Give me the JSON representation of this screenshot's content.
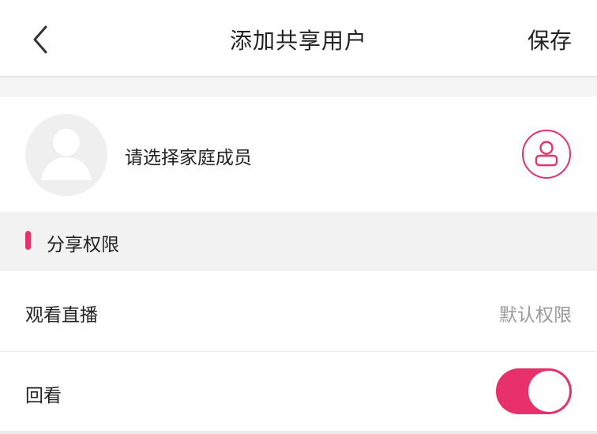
{
  "header": {
    "title": "添加共享用户",
    "save_label": "保存",
    "back_icon": "chevron-left-icon"
  },
  "member": {
    "prompt": "请选择家庭成员",
    "avatar_icon": "default-avatar-icon",
    "select_icon": "user-icon"
  },
  "permissions": {
    "section_title": "分享权限",
    "rows": [
      {
        "label": "观看直播",
        "value": "默认权限"
      },
      {
        "label": "回看",
        "toggle_on": true
      }
    ]
  },
  "colors": {
    "accent": "#e8306a",
    "secondary_text": "#9a9a9a",
    "background": "#f5f5f5"
  }
}
